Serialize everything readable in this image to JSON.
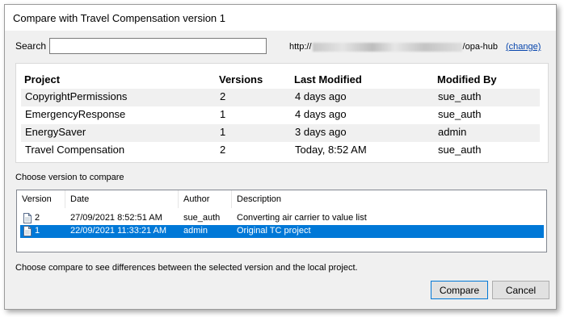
{
  "window": {
    "title": "Compare with Travel Compensation version 1"
  },
  "search": {
    "label": "Search",
    "value": "",
    "placeholder": ""
  },
  "server": {
    "url_prefix": "http://",
    "url_suffix": "/opa-hub",
    "change_link": "(change)"
  },
  "projects": {
    "columns": [
      "Project",
      "Versions",
      "Last Modified",
      "Modified By"
    ],
    "rows": [
      [
        "CopyrightPermissions",
        "2",
        "4 days ago",
        "sue_auth"
      ],
      [
        "EmergencyResponse",
        "1",
        "4 days ago",
        "sue_auth"
      ],
      [
        "EnergySaver",
        "1",
        "3 days ago",
        "admin"
      ],
      [
        "Travel Compensation",
        "2",
        "Today, 8:52 AM",
        "sue_auth"
      ]
    ]
  },
  "versions": {
    "label": "Choose version to compare",
    "columns": [
      "Version",
      "Date",
      "Author",
      "Description"
    ],
    "rows": [
      [
        "2",
        "27/09/2021 8:52:51 AM",
        "sue_auth",
        "Converting air carrier to value list"
      ],
      [
        "1",
        "22/09/2021 11:33:21 AM",
        "admin",
        "Original TC project"
      ]
    ],
    "selected_index": 1,
    "row_icon": "document-icon"
  },
  "footer": {
    "hint": "Choose compare to see differences between the selected version and the local project."
  },
  "buttons": {
    "compare": "Compare",
    "cancel": "Cancel"
  },
  "colors": {
    "selection": "#0078d7",
    "link": "#0645ad",
    "dialog_bg": "#f0f0f0"
  }
}
